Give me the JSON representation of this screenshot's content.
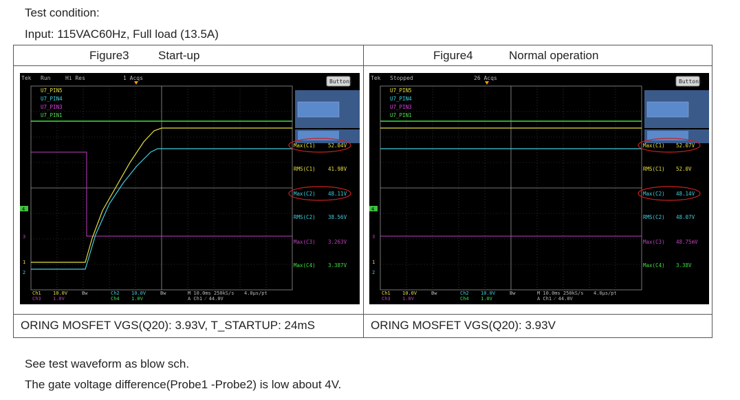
{
  "test_condition": "Test condition:",
  "input_line": "Input: 115VAC60Hz, Full load (13.5A)",
  "left": {
    "figure": "Figure3",
    "mode": "Start-up",
    "caption": "ORING MOSFET VGS(Q20): 3.93V, T_STARTUP: 24mS",
    "scope": {
      "brand": "Tek",
      "state": "Run",
      "acq_mode": "Hi Res",
      "acqs": "1 Acqs",
      "buttons": "Buttons",
      "legend": [
        "U7_PIN5",
        "U7_PIN4",
        "U7_PIN3",
        "U7_PIN1"
      ],
      "measurements": [
        {
          "label": "Max(C1)",
          "value": "52.04V"
        },
        {
          "label": "RMS(C1)",
          "value": "41.98V"
        },
        {
          "label": "Max(C2)",
          "value": "48.11V"
        },
        {
          "label": "RMS(C2)",
          "value": "38.56V"
        },
        {
          "label": "Max(C3)",
          "value": "3.263V"
        },
        {
          "label": "Max(C4)",
          "value": "3.387V"
        }
      ],
      "bottom": {
        "ch1": "Ch1",
        "ch1v": "10.0V",
        "ch3": "Ch3",
        "ch3v": "1.0V",
        "ch2": "Ch2",
        "ch2v": "10.0V",
        "ch4": "Ch4",
        "ch4v": "1.0V",
        "bw1": "Bw",
        "bw2": "Bw",
        "timebase": "M 10.0ms 250kS/s",
        "pts": "4.0µs/pt",
        "trigger": "A  Ch1  ⁄  44.0V"
      },
      "markers": {
        "m4": "4",
        "m3": "3",
        "m1": "1",
        "m2": "2"
      }
    }
  },
  "right": {
    "figure": "Figure4",
    "mode": "Normal operation",
    "caption": "ORING MOSFET VGS(Q20): 3.93V",
    "scope": {
      "brand": "Tek",
      "state": "Stopped",
      "acqs": "26 Acqs",
      "buttons": "Buttons",
      "legend": [
        "U7_PIN5",
        "U7_PIN4",
        "U7_PIN3",
        "U7_PIN1"
      ],
      "measurements": [
        {
          "label": "Max(C1)",
          "value": "52.07V"
        },
        {
          "label": "RMS(C1)",
          "value": "52.0V"
        },
        {
          "label": "Max(C2)",
          "value": "48.14V"
        },
        {
          "label": "RMS(C2)",
          "value": "48.07V"
        },
        {
          "label": "Max(C3)",
          "value": "48.75mV"
        },
        {
          "label": "Max(C4)",
          "value": "3.38V"
        }
      ],
      "bottom": {
        "ch1": "Ch1",
        "ch1v": "10.0V",
        "ch3": "Ch3",
        "ch3v": "1.0V",
        "ch2": "Ch2",
        "ch2v": "10.0V",
        "ch4": "Ch4",
        "ch4v": "1.0V",
        "bw1": "Bw",
        "bw2": "Bw",
        "timebase": "M 10.0ms 250kS/s",
        "pts": "4.0µs/pt",
        "trigger": "A  Ch1  ⁄  44.0V"
      },
      "markers": {
        "m4": "4",
        "m3": "3",
        "m1": "1",
        "m2": "2"
      }
    }
  },
  "note1": "See test waveform as blow sch.",
  "note2": "The gate voltage difference(Probe1 -Probe2) is low about 4V."
}
